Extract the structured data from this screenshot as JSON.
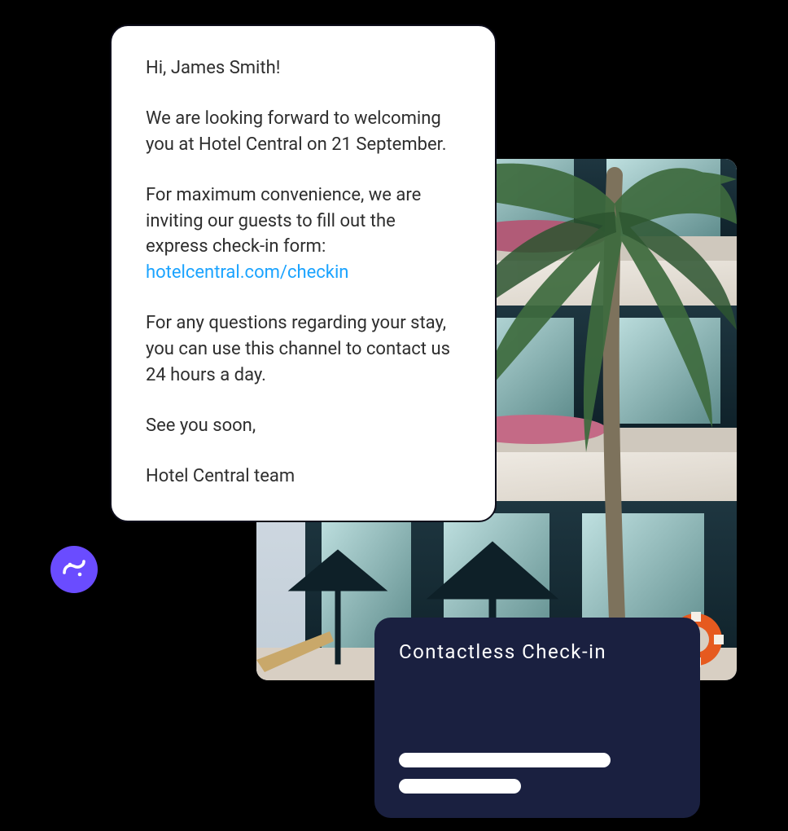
{
  "message": {
    "greeting": "Hi, James Smith!",
    "welcome": "We are looking forward to welcoming you at Hotel Central on 21 September.",
    "invite_pre": "For maximum convenience, we are inviting our guests to fill out the express check-in form: ",
    "link_text": "hotelcentral.com/checkin",
    "support": "For any questions regarding your stay, you can use this channel to contact us 24 hours a day.",
    "closing": "See you soon,",
    "signature": "Hotel Central team"
  },
  "checkin": {
    "title": "Contactless Check-in"
  },
  "colors": {
    "brand_badge": "#6a4cff",
    "link": "#1aa3ff",
    "checkin_bg": "#1a2040",
    "card_border": "#0d0d1a"
  }
}
